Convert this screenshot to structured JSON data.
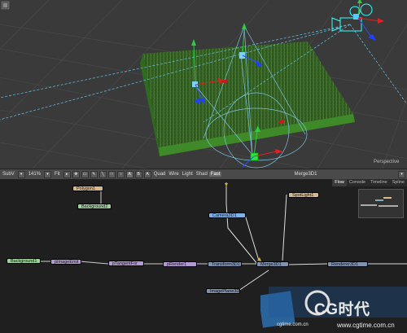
{
  "viewport": {
    "view_label": "Perspective",
    "merge_label": "Merge3D1"
  },
  "toolbar": {
    "subv": "SubV",
    "zoom": "141%",
    "fit": "Fit",
    "tools": [
      "A",
      "B",
      "A"
    ],
    "modes": [
      "Quad",
      "Wire",
      "Light",
      "Shad",
      "Fast"
    ]
  },
  "flow_tabs": [
    "Flow",
    "Console",
    "Timeline",
    "Spline"
  ],
  "nodes": {
    "polygon1": "Polygon1",
    "background2": "Background2",
    "camera3d1": "Camera3D1",
    "spotlight1": "SpotLight1",
    "background1": "Background1",
    "pimageemit": "pImageEmit",
    "ptangentfor": "pTangentFor",
    "prender1": "pRender1",
    "transform3d1": "Transform3D1",
    "merge3d1": "Merge3D1",
    "renderer3d1": "Renderer3D1",
    "imageplane3d": "ImagePlane3D"
  },
  "watermark": {
    "logo_text": "CG时代",
    "sub_text": "cgtime.com.cn",
    "url": "www.cgtime.com.cn"
  }
}
